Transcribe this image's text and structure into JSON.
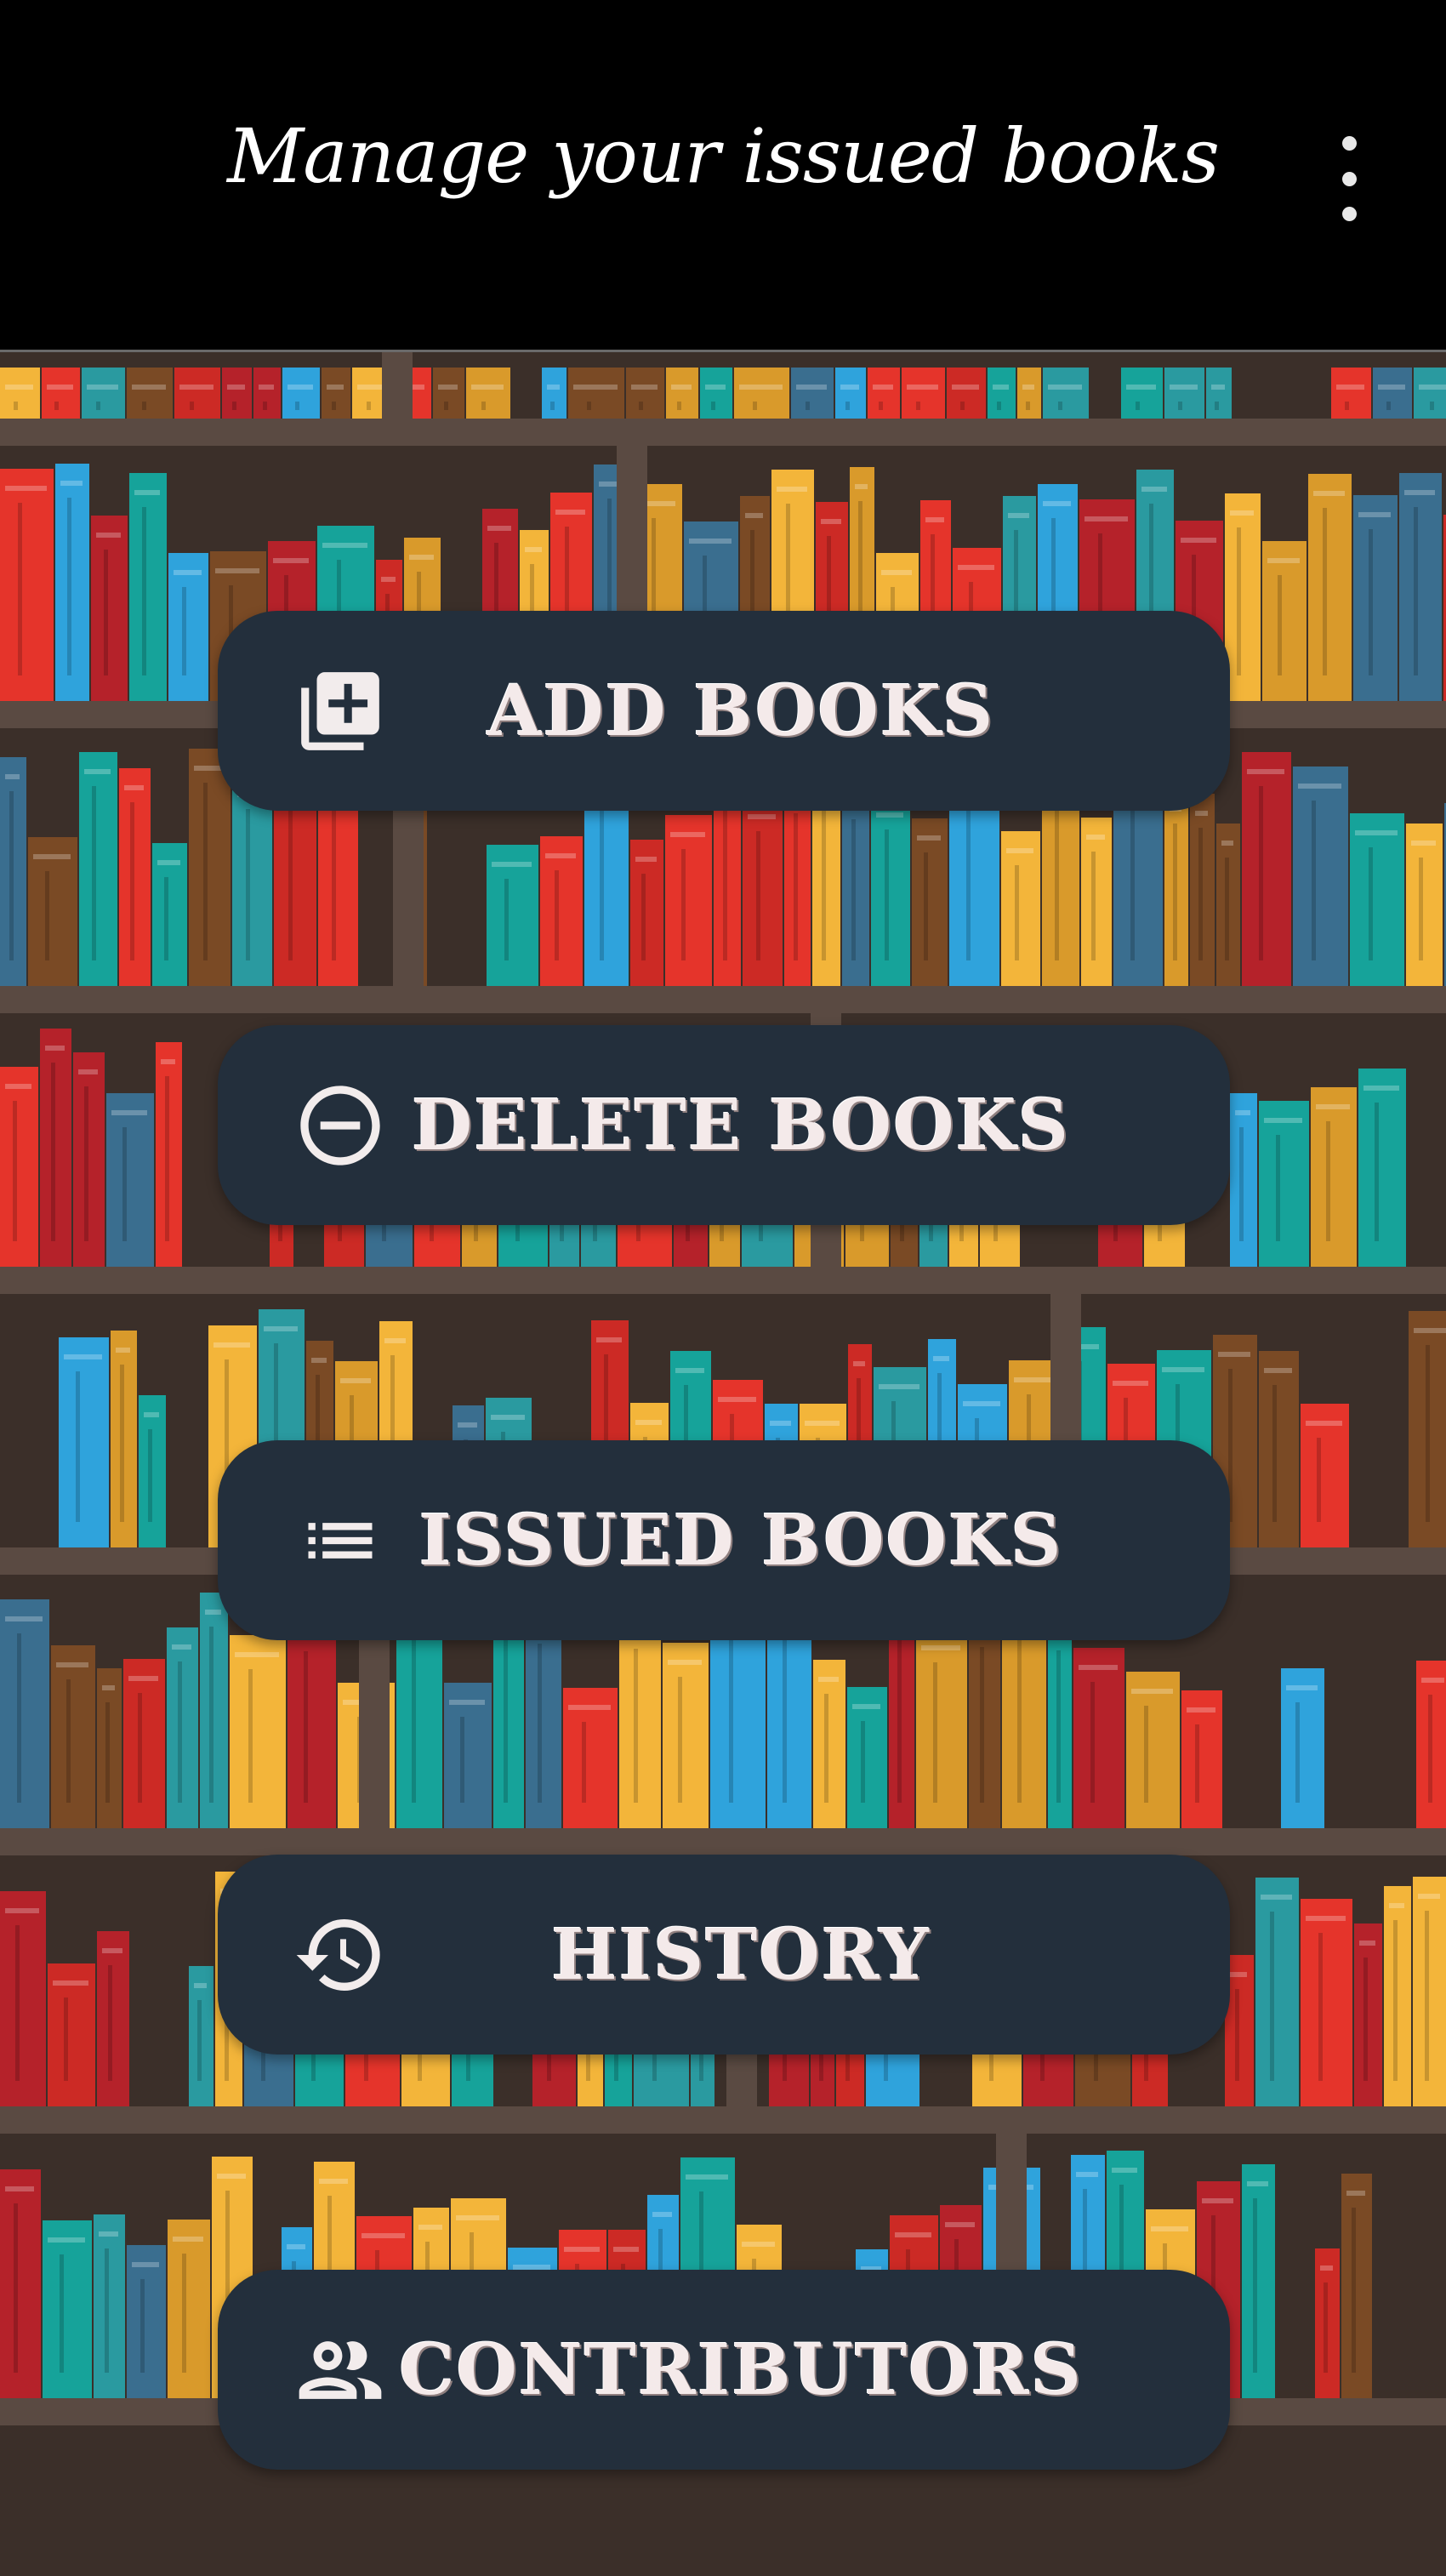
{
  "appbar": {
    "title": "Manage your issued books",
    "overflow_icon": "more-vert-icon"
  },
  "colors": {
    "appbar_bg": "#000000",
    "button_bg": "#232f3c",
    "button_text": "#f4eaea",
    "shelf_wood": "#5a4a42",
    "shelf_back": "#3b2f29"
  },
  "menu": {
    "add": {
      "label": "ADD BOOKS",
      "icon": "library-add-icon"
    },
    "delete": {
      "label": "DELETE BOOKS",
      "icon": "remove-circle-icon"
    },
    "issued": {
      "label": "ISSUED BOOKS",
      "icon": "list-icon"
    },
    "history": {
      "label": "HISTORY",
      "icon": "history-icon"
    },
    "contributors": {
      "label": "CONTRIBUTORS",
      "icon": "people-icon"
    }
  }
}
